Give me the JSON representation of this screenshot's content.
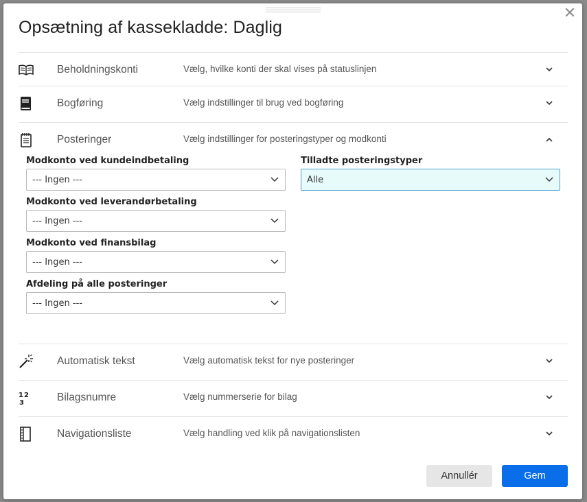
{
  "dialog": {
    "title": "Opsætning af kassekladde: Daglig",
    "close_icon": "close-icon"
  },
  "sections": [
    {
      "name": "Beholdningskonti",
      "desc": "Vælg, hvilke konti der skal vises på statuslinjen",
      "icon": "book-open-icon",
      "expanded": false
    },
    {
      "name": "Bogføring",
      "desc": "Vælg indstillinger til brug ved bogføring",
      "icon": "ledger-book-icon",
      "expanded": false
    },
    {
      "name": "Posteringer",
      "desc": "Vælg indstillinger for posteringstyper og modkonti",
      "icon": "notepad-icon",
      "expanded": true
    },
    {
      "name": "Automatisk tekst",
      "desc": "Vælg automatisk tekst for nye posteringer",
      "icon": "magic-wand-icon",
      "expanded": false
    },
    {
      "name": "Bilagsnumre",
      "desc": "Vælg nummerserie for bilag",
      "icon": "numbers-icon",
      "expanded": false
    },
    {
      "name": "Navigationsliste",
      "desc": "Vælg handling ved klik på navigationslisten",
      "icon": "list-panel-icon",
      "expanded": false
    }
  ],
  "posteringer": {
    "kunde_label": "Modkonto ved kundeindbetaling",
    "kunde_value": "--- Ingen ---",
    "leverandor_label": "Modkonto ved leverandørbetaling",
    "leverandor_value": "--- Ingen ---",
    "finans_label": "Modkonto ved finansbilag",
    "finans_value": "--- Ingen ---",
    "afdeling_label": "Afdeling på alle posteringer",
    "afdeling_value": "--- Ingen ---",
    "typer_label": "Tilladte posteringstyper",
    "typer_value": "Alle"
  },
  "buttons": {
    "cancel": "Annullér",
    "save": "Gem"
  },
  "colors": {
    "primary": "#0a6dea",
    "active_select_bg": "#e7fbfb",
    "active_select_border": "#4a9ed0"
  }
}
